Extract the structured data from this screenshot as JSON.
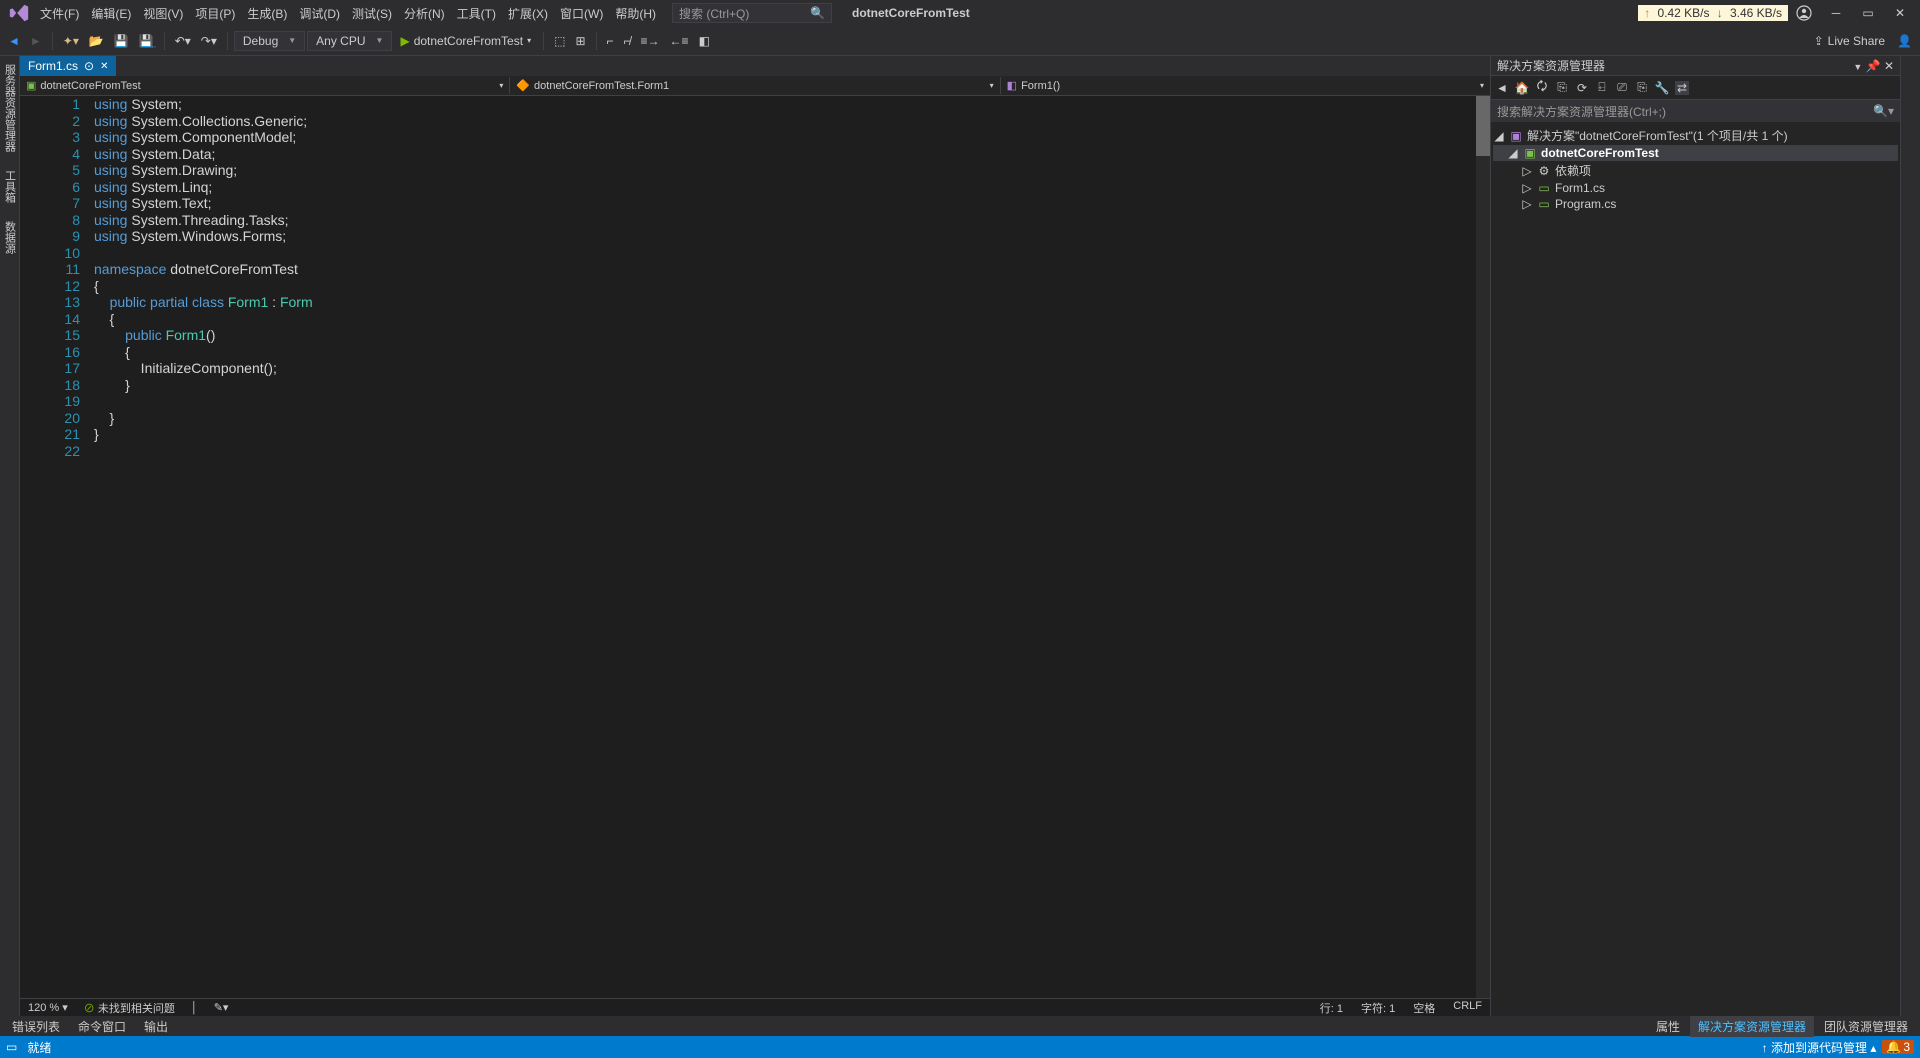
{
  "menu": {
    "file": "文件(F)",
    "edit": "编辑(E)",
    "view": "视图(V)",
    "project": "项目(P)",
    "build": "生成(B)",
    "debug": "调试(D)",
    "test": "测试(S)",
    "analyze": "分析(N)",
    "tools": "工具(T)",
    "extensions": "扩展(X)",
    "window": "窗口(W)",
    "help": "帮助(H)"
  },
  "titlebar": {
    "search_placeholder": "搜索 (Ctrl+Q)",
    "app_title": "dotnetCoreFromTest",
    "net_up": "0.42 KB/s",
    "net_down": "3.46 KB/s"
  },
  "toolbar": {
    "config": "Debug",
    "platform": "Any CPU",
    "start": "dotnetCoreFromTest",
    "liveshare": "Live Share"
  },
  "tab": {
    "name": "Form1.cs"
  },
  "nav": {
    "project": "dotnetCoreFromTest",
    "class": "dotnetCoreFromTest.Form1",
    "method": "Form1()"
  },
  "lines": [
    "1",
    "2",
    "3",
    "4",
    "5",
    "6",
    "7",
    "8",
    "9",
    "10",
    "11",
    "12",
    "13",
    "14",
    "15",
    "16",
    "17",
    "18",
    "19",
    "20",
    "21",
    "22"
  ],
  "code_tokens": [
    [
      {
        "t": "using ",
        "c": "kw"
      },
      {
        "t": "System;",
        "c": "pln"
      }
    ],
    [
      {
        "t": "using ",
        "c": "kw"
      },
      {
        "t": "System.Collections.Generic;",
        "c": "pln"
      }
    ],
    [
      {
        "t": "using ",
        "c": "kw"
      },
      {
        "t": "System.ComponentModel;",
        "c": "pln"
      }
    ],
    [
      {
        "t": "using ",
        "c": "kw"
      },
      {
        "t": "System.Data;",
        "c": "pln"
      }
    ],
    [
      {
        "t": "using ",
        "c": "kw"
      },
      {
        "t": "System.Drawing;",
        "c": "pln"
      }
    ],
    [
      {
        "t": "using ",
        "c": "kw"
      },
      {
        "t": "System.Linq;",
        "c": "pln"
      }
    ],
    [
      {
        "t": "using ",
        "c": "kw"
      },
      {
        "t": "System.Text;",
        "c": "pln"
      }
    ],
    [
      {
        "t": "using ",
        "c": "kw"
      },
      {
        "t": "System.Threading.Tasks;",
        "c": "pln"
      }
    ],
    [
      {
        "t": "using ",
        "c": "kw"
      },
      {
        "t": "System.Windows.Forms;",
        "c": "pln"
      }
    ],
    [
      {
        "t": "",
        "c": "pln"
      }
    ],
    [
      {
        "t": "namespace ",
        "c": "kw"
      },
      {
        "t": "dotnetCoreFromTest",
        "c": "pln"
      }
    ],
    [
      {
        "t": "{",
        "c": "pln"
      }
    ],
    [
      {
        "t": "    ",
        "c": "pln"
      },
      {
        "t": "public partial class ",
        "c": "kw"
      },
      {
        "t": "Form1",
        "c": "cls"
      },
      {
        "t": " : ",
        "c": "pln"
      },
      {
        "t": "Form",
        "c": "cls"
      }
    ],
    [
      {
        "t": "    {",
        "c": "pln"
      }
    ],
    [
      {
        "t": "        ",
        "c": "pln"
      },
      {
        "t": "public ",
        "c": "kw"
      },
      {
        "t": "Form1",
        "c": "cls"
      },
      {
        "t": "()",
        "c": "pln"
      }
    ],
    [
      {
        "t": "        {",
        "c": "pln"
      }
    ],
    [
      {
        "t": "            InitializeComponent();",
        "c": "pln"
      }
    ],
    [
      {
        "t": "        }",
        "c": "pln"
      }
    ],
    [
      {
        "t": "",
        "c": "pln"
      }
    ],
    [
      {
        "t": "    }",
        "c": "pln"
      }
    ],
    [
      {
        "t": "}",
        "c": "pln"
      }
    ],
    [
      {
        "t": "",
        "c": "pln"
      }
    ]
  ],
  "editor_status": {
    "zoom": "120 %",
    "issues": "未找到相关问题",
    "line": "行: 1",
    "col": "字符: 1",
    "spaces": "空格",
    "ending": "CRLF"
  },
  "solution": {
    "panel_title": "解决方案资源管理器",
    "search_placeholder": "搜索解决方案资源管理器(Ctrl+;)",
    "root": "解决方案\"dotnetCoreFromTest\"(1 个项目/共 1 个)",
    "project": "dotnetCoreFromTest",
    "deps": "依赖项",
    "form": "Form1.cs",
    "program": "Program.cs"
  },
  "bottom_tabs": {
    "errors": "错误列表",
    "cmd": "命令窗口",
    "output": "输出",
    "props": "属性",
    "solx": "解决方案资源管理器",
    "team": "团队资源管理器"
  },
  "statusbar": {
    "ready": "就绪",
    "source": "添加到源代码管理",
    "notif": "3"
  },
  "left_tabs": {
    "server": "服务器资源管理器",
    "toolbox": "工具箱",
    "datasrc": "数据源"
  }
}
